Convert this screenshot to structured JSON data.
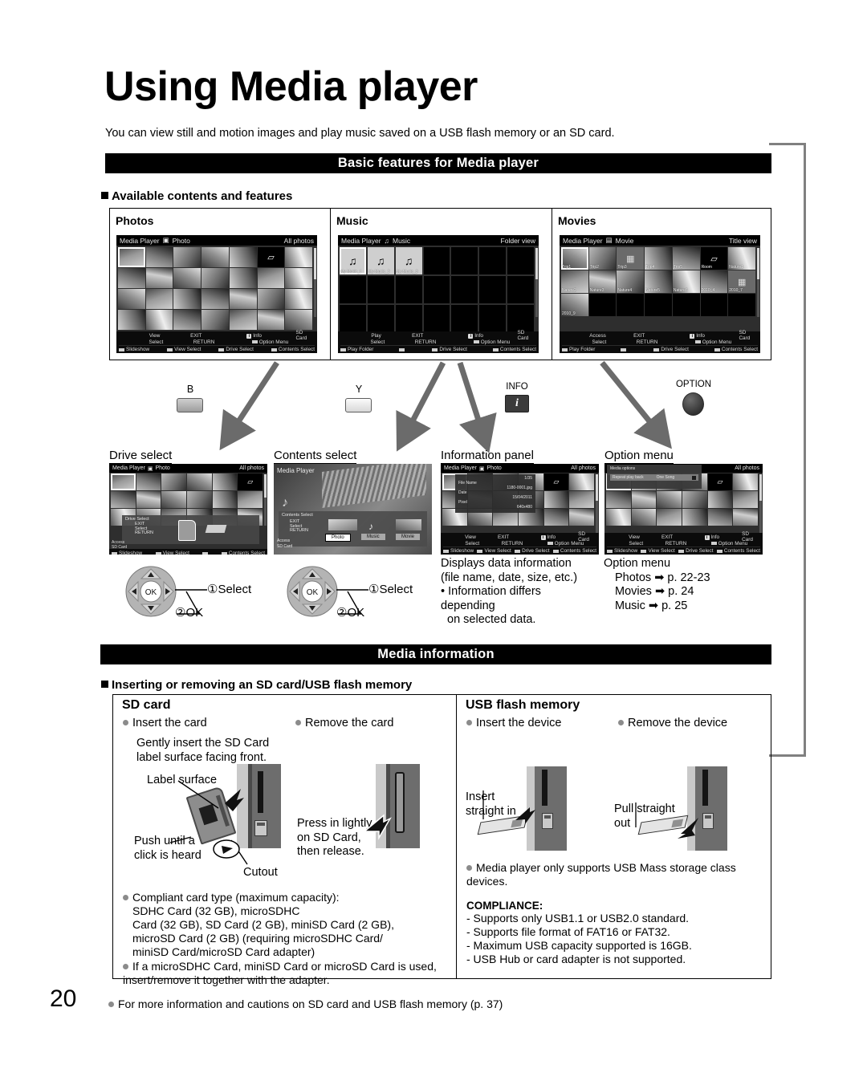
{
  "page": {
    "number": "20",
    "title": "Using Media player",
    "lead": "You can view still and motion images and play music saved on a USB flash memory or an SD card.",
    "footnote": "For more information and cautions on SD card and USB flash memory (p. 37)"
  },
  "section_basic": {
    "bar_title": "Basic features for Media player",
    "subhead": "Available contents and features",
    "columns": [
      {
        "label": "Photos"
      },
      {
        "label": "Music"
      },
      {
        "label": "Movies"
      }
    ]
  },
  "screens": {
    "photos": {
      "header_app": "Media Player",
      "header_mode": "Photo",
      "header_right": "All photos",
      "footer": {
        "action1": "View",
        "action2": "Select",
        "exit": "EXIT",
        "return": "RETURN",
        "info": "Info",
        "option": "Option Menu",
        "drive": "SD Card",
        "color1": "Slideshow",
        "color2": "View Select",
        "color3": "Drive Select",
        "color4": "Contents Select"
      }
    },
    "music": {
      "header_app": "Media Player",
      "header_mode": "Music",
      "header_right": "Folder view",
      "items": [
        "My Music_1",
        "My Music_2",
        "My Music_3"
      ],
      "footer": {
        "action1": "Play",
        "action2": "Select",
        "exit": "EXIT",
        "return": "RETURN",
        "info": "Info",
        "option": "Option Menu",
        "drive": "SD Card",
        "color1": "Play Folder",
        "color2": "",
        "color3": "Drive Select",
        "color4": "Contents Select"
      }
    },
    "movies": {
      "header_app": "Media Player",
      "header_mode": "Movie",
      "header_right": "Title view",
      "items_row1": [
        "Trip1",
        "Trip2",
        "Trip3",
        "Trip4",
        "Trip5",
        "Room",
        "Nature1"
      ],
      "items_row2": [
        "Nature2",
        "Nature3",
        "Nature4",
        "Nature5",
        "Nature6",
        "2010_4",
        "2010_7"
      ],
      "items_row3": [
        "2010_9"
      ],
      "footer": {
        "action1": "Access",
        "action2": "Select",
        "exit": "EXIT",
        "return": "RETURN",
        "info": "Info",
        "option": "Option Menu",
        "drive": "SD Card",
        "color1": "Play Folder",
        "color2": "",
        "color3": "Drive Select",
        "color4": "Contents Select"
      }
    },
    "drive_select": {
      "header_app": "Media Player",
      "header_mode": "Photo",
      "header_right": "All photos",
      "dialog_title": "Drive Select",
      "dialog_keys": [
        "EXIT",
        "Select",
        "RETURN"
      ],
      "dialog_labels": [
        "Access",
        "SD Card"
      ]
    },
    "contents_select": {
      "header_app": "Media Player",
      "dialog_title": "Contents Select",
      "dialog_keys": [
        "EXIT",
        "Select",
        "RETURN"
      ],
      "dialog_labels": [
        "Access",
        "SD Card"
      ],
      "options": [
        "Photo",
        "Music",
        "Movie"
      ]
    },
    "information_panel": {
      "header_app": "Media Player",
      "header_mode": "Photo",
      "header_right": "All photos",
      "rows": [
        {
          "key": "",
          "value": "1/35"
        },
        {
          "key": "File Name",
          "value": "1180-0001.jpg"
        },
        {
          "key": "Date",
          "value": "15/04/2011"
        },
        {
          "key": "Pixel",
          "value": "640x480"
        }
      ]
    },
    "option_menu": {
      "header_right": "All photos",
      "dialog_title": "Media options",
      "row_label": "Repeat play back",
      "row_value": "One Song"
    }
  },
  "remote": {
    "b_key": "B",
    "y_key": "Y",
    "info_key_label": "INFO",
    "info_key_glyph": "i",
    "option_key_label": "OPTION"
  },
  "callouts": [
    {
      "name": "drive-select",
      "label": "Drive select"
    },
    {
      "name": "contents-select",
      "label": "Contents select"
    },
    {
      "name": "information-panel",
      "label": "Information panel"
    },
    {
      "name": "option-menu",
      "label": "Option menu"
    }
  ],
  "nav_hints": {
    "step1": "Select",
    "step2": "OK",
    "num1": "①",
    "num2": "②",
    "ok_text": "OK"
  },
  "info_desc": {
    "line1": "Displays data information",
    "line2": "(file name, date, size, etc.)",
    "line3": "• Information differs depending",
    "line4": "on selected data."
  },
  "option_desc": {
    "title": "Option menu",
    "items": [
      {
        "label": "Photos",
        "page": "p. 22-23"
      },
      {
        "label": "Movies",
        "page": "p. 24"
      },
      {
        "label": "Music",
        "page": "p. 25"
      }
    ]
  },
  "section_media": {
    "bar_title": "Media information",
    "subhead": "Inserting or removing an SD card/USB flash memory",
    "sd": {
      "title": "SD card",
      "col1_head": "Insert the card",
      "col2_head": "Remove the card",
      "instruction1": "Gently insert the SD Card",
      "instruction2": "label surface facing front.",
      "label_surface": "Label surface",
      "push_line1": "Push until a",
      "push_line2": "click is heard",
      "cutout": "Cutout",
      "press_line1": "Press in lightly",
      "press_line2": "on SD Card,",
      "press_line3": "then release.",
      "notes": [
        "Compliant card type (maximum capacity):",
        "SDHC Card (32 GB), microSDHC",
        "Card (32 GB), SD Card (2 GB), miniSD Card (2 GB),",
        "microSD Card (2 GB) (requiring microSDHC Card/",
        "miniSD Card/microSD Card adapter)"
      ],
      "note2": "If a microSDHC Card, miniSD Card or microSD Card is used, insert/remove it together with the adapter."
    },
    "usb": {
      "title": "USB flash memory",
      "col1_head": "Insert the device",
      "col2_head": "Remove the device",
      "insert_line1": "Insert",
      "insert_line2": "straight in",
      "pull_line1": "Pull straight",
      "pull_line2": "out",
      "note1": "Media player only supports USB Mass storage class devices.",
      "compliance_title": "COMPLIANCE:",
      "compliance": [
        "- Supports only USB1.1 or USB2.0 standard.",
        "- Supports file format of FAT16 or FAT32.",
        "- Maximum USB capacity supported is 16GB.",
        "- USB Hub or card adapter is not supported."
      ]
    }
  }
}
